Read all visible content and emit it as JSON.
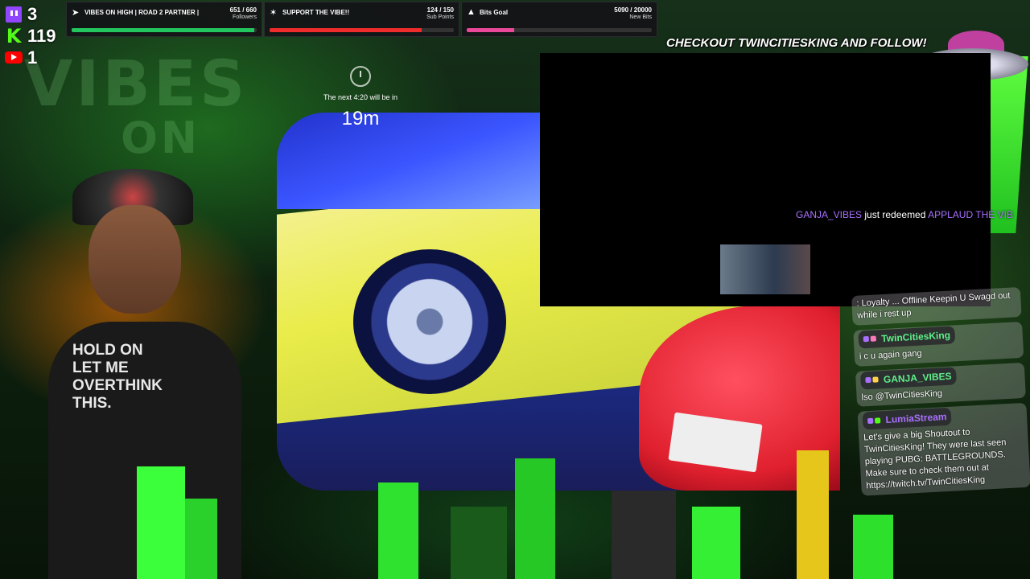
{
  "stats": [
    {
      "icon": "twitch-icon",
      "value": "3"
    },
    {
      "icon": "kick-icon",
      "value": "119"
    },
    {
      "icon": "youtube-icon",
      "value": "1"
    }
  ],
  "goals": [
    {
      "icon": "rocket-icon",
      "name": "VIBES ON HIGH | ROAD 2 PARTNER |",
      "value": "651 / 660",
      "sub": "Followers",
      "progress": 0.986,
      "color": "#22c55e"
    },
    {
      "icon": "star-icon",
      "name": "SUPPORT THE VIBE!!",
      "value": "124 / 150",
      "sub": "Sub Points",
      "progress": 0.827,
      "color": "#ef2b2b"
    },
    {
      "icon": "bits-icon",
      "name": "Bits Goal",
      "value": "5090 / 20000",
      "sub": "New Bits",
      "progress": 0.2545,
      "color": "#ec4899"
    }
  ],
  "timer": {
    "caption": "The next 4:20 will be in",
    "value": "19m"
  },
  "checkout": "CHECKOUT TWINCITIESKING AND FOLLOW!",
  "redeem": {
    "user": "GANJA_VIBES",
    "middle": " just redeemed ",
    "reward": "APPLAUD THE VIB"
  },
  "chat": [
    {
      "user": "",
      "text": ": Loyalty ... Offline Keepin U Swagd out while i rest up"
    },
    {
      "user": "TwinCitiesKing",
      "user_color": "#5ef08a",
      "text": "i c u again gang"
    },
    {
      "user": "GANJA_VIBES",
      "user_color": "#5ef08a",
      "text": "lso @TwinCitiesKing"
    },
    {
      "user": "LumiaStream",
      "user_color": "#a970ff",
      "text": "Let's give a big Shoutout to TwinCitiesKing! They were last seen playing PUBG: BATTLEGROUNDS. Make sure to check them out at https://twitch.tv/TwinCitiesKing"
    }
  ],
  "shirt_text": "HOLD ON\nLET ME\nOVERTHINK\nTHIS.",
  "colors": {
    "twitch": "#9146ff",
    "kick": "#53fc18",
    "youtube": "#ff0000"
  }
}
